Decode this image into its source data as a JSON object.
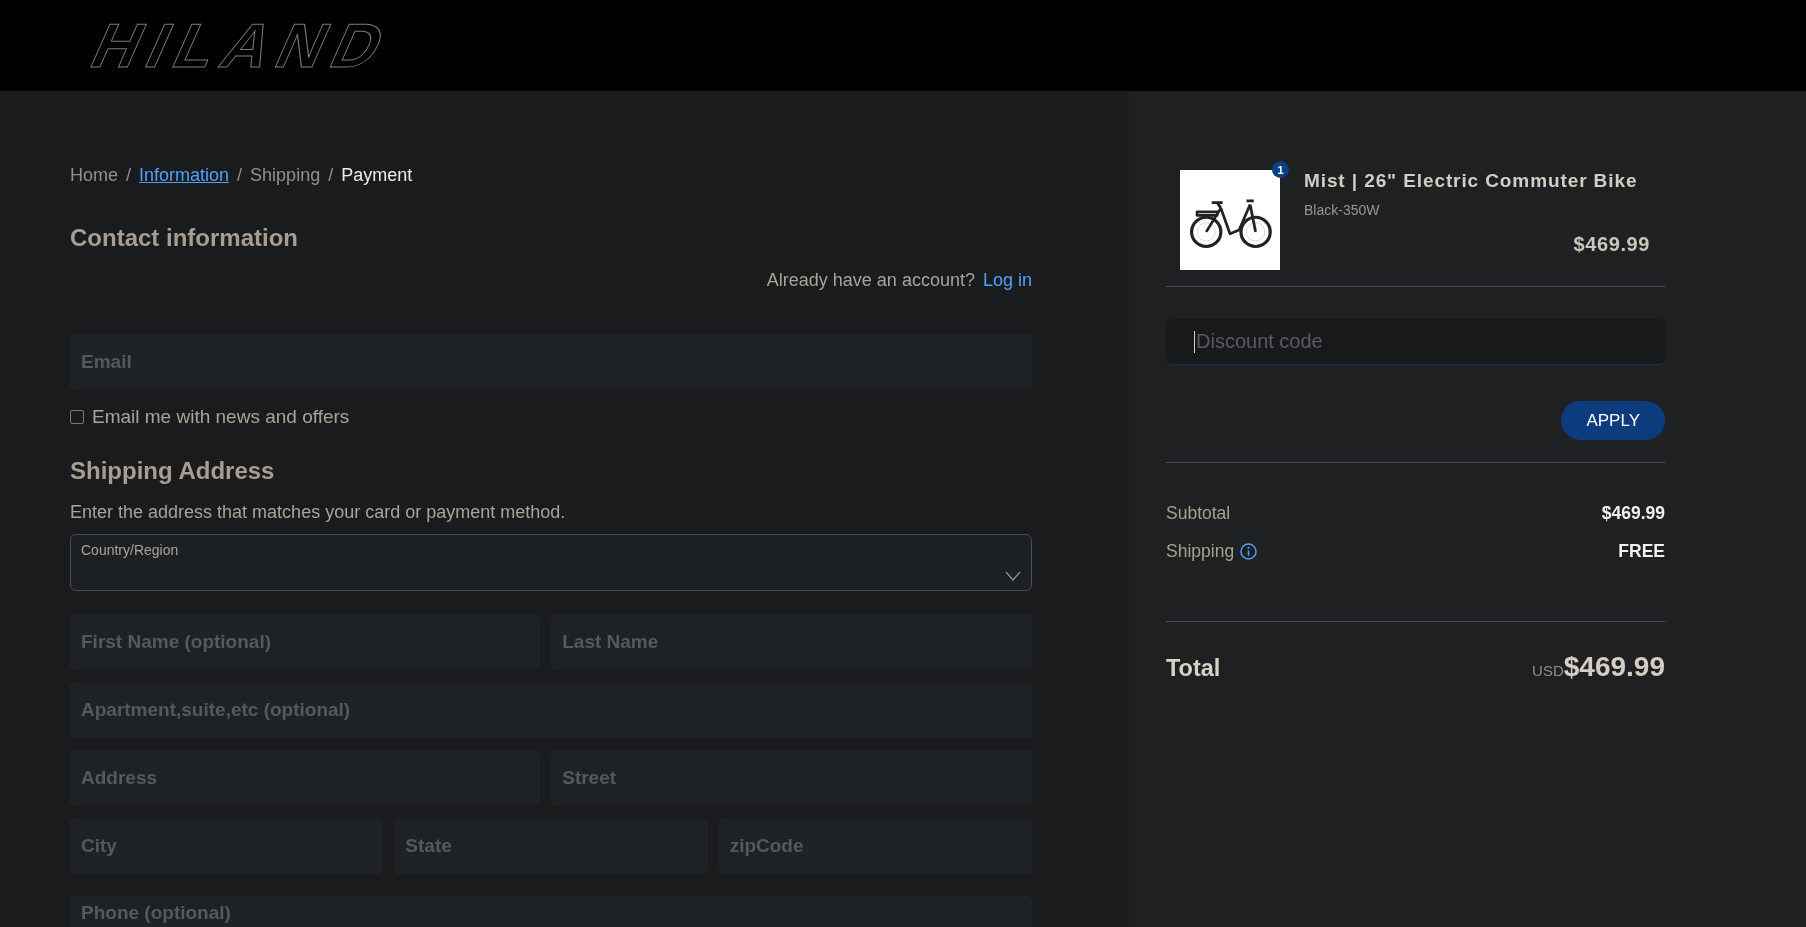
{
  "header": {
    "logo": "HILAND"
  },
  "breadcrumb": [
    {
      "kind": "plain",
      "label": "Home"
    },
    {
      "kind": "separator",
      "label": "/"
    },
    {
      "kind": "link",
      "label": "Information"
    },
    {
      "kind": "separator",
      "label": "/"
    },
    {
      "kind": "plain",
      "label": "Shipping"
    },
    {
      "kind": "separator",
      "label": "/"
    },
    {
      "kind": "current",
      "label": "Payment"
    }
  ],
  "contact": {
    "title": "Contact information",
    "account_prompt": "Already have an account?",
    "login_link": "Log in",
    "email": {
      "placeholder": "Email"
    },
    "newsletter": {
      "label": "Email me with news and offers",
      "checked": false
    }
  },
  "shipping": {
    "title": "Shipping Address",
    "subtitle": "Enter the address that matches your card or payment method.",
    "country": {
      "label": "Country/Region"
    },
    "rows": [
      {
        "fields": [
          {
            "placeholder": "First Name (optional)"
          },
          {
            "placeholder": "Last Name"
          }
        ]
      },
      {
        "fields": [
          {
            "placeholder": "Apartment,suite,etc (optional)"
          }
        ]
      },
      {
        "fields": [
          {
            "placeholder": "Address"
          },
          {
            "placeholder": "Street"
          }
        ]
      },
      {
        "fields": [
          {
            "placeholder": "City"
          },
          {
            "placeholder": "State"
          },
          {
            "placeholder": "zipCode"
          }
        ]
      },
      {
        "fields": [
          {
            "placeholder": "Phone (optional)"
          }
        ]
      }
    ]
  },
  "summary": {
    "item": {
      "name": "Mist | 26\" Electric Commuter Bike",
      "variant": "Black-350W",
      "price": "$469.99",
      "quantity": "1"
    },
    "discount": {
      "placeholder": "Discount code",
      "focused": true
    },
    "apply_button": "APPLY",
    "lines": [
      {
        "label": "Subtotal",
        "value": "$469.99",
        "info": false
      },
      {
        "label": "Shipping",
        "value": "FREE",
        "info": true
      }
    ],
    "total": {
      "label": "Total",
      "currency": "USD",
      "value": "$469.99"
    }
  }
}
